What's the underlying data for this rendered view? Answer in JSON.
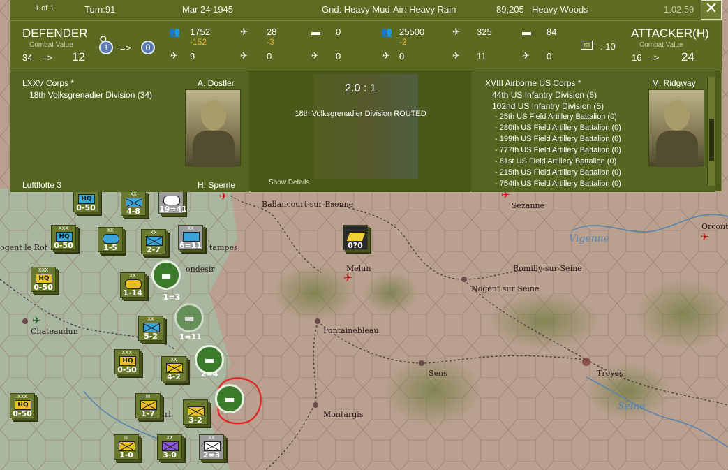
{
  "header": {
    "page": "1 of 1",
    "turn": "Turn:91",
    "date": "Mar 24 1945",
    "ground": "Gnd: Heavy Mud",
    "air": "Air: Heavy Rain",
    "terrain_count": "89,205",
    "terrain": "Heavy Woods",
    "version": "1.02.59",
    "close_icon": "close-icon"
  },
  "defender": {
    "title": "DEFENDER",
    "cv_label": "Combat Value",
    "cv_from": "34",
    "arrow": "=>",
    "cv_to": "12",
    "men": "1752",
    "men_loss": "-152",
    "guns": "9",
    "aa": "28",
    "aa_loss": "-3",
    "planes": "0",
    "tanks": "0",
    "air2": "0",
    "fort_from": "1",
    "fort_to": "0",
    "corps": "LXXV Corps *",
    "commander": "A. Dostler",
    "divisions": [
      "18th Volksgrenadier Division (34)"
    ],
    "cut_label": "Luftflotte 3",
    "cut_commander": "H. Sperrle"
  },
  "center": {
    "odds": "2.0 : 1",
    "result": "18th Volksgrenadier Division ROUTED",
    "show_details": "Show Details"
  },
  "attacker": {
    "title": "ATTACKER(H)",
    "cv_label": "Combat Value",
    "cv_from": "16",
    "arrow": "=>",
    "cv_to": "24",
    "men": "25500",
    "men_loss": "-2",
    "guns": "0",
    "aa": "325",
    "planes": "11",
    "tanks": "84",
    "air2": "0",
    "bridge_val": ": 10",
    "corps": "XVIII Airborne US Corps *",
    "commander": "M. Ridgway",
    "divisions": [
      "44th US Infantry Division (6)",
      "102nd US Infantry Division (5)"
    ],
    "units": [
      "- 25th US Field Artillery Battalion (0)",
      "- 280th US Field Artillery Battalion (0)",
      "- 199th US Field Artillery Battalion (0)",
      "- 777th US Field Artillery Battalion (0)",
      "- 81st US Field Artillery Battalion (0)",
      "- 215th US Field Artillery Battalion (0)",
      "- 754th US Field Artillery Battalion (0)"
    ]
  },
  "map": {
    "towns": [
      "Ballancourt-sur-Esonne",
      "Sezanne",
      "Orconte",
      "ogent le Rot",
      "tampes",
      "ondesir",
      "Melun",
      "Romilly-sur-Seine",
      "Nogent sur Seine",
      "Chateaudun",
      "Fontainebleau",
      "Sens",
      "Troyes",
      "Montargis",
      "rl"
    ],
    "rivers": [
      "Vigenne",
      "Seine"
    ],
    "units": [
      {
        "echelon": "",
        "value": "0-50",
        "type": "HQ"
      },
      {
        "echelon": "XX",
        "value": "4-8",
        "type": "inf"
      },
      {
        "echelon": "",
        "value": "19=41",
        "type": "arm"
      },
      {
        "echelon": "XXX",
        "value": "0-50",
        "type": "HQ"
      },
      {
        "echelon": "XX",
        "value": "1-5",
        "type": "arm"
      },
      {
        "echelon": "XX",
        "value": "2-7",
        "type": "inf"
      },
      {
        "echelon": "XX",
        "value": "6=11",
        "type": "gr"
      },
      {
        "echelon": "",
        "value": "0?0",
        "type": "para"
      },
      {
        "echelon": "XXX",
        "value": "0-50",
        "type": "HQ"
      },
      {
        "echelon": "XX",
        "value": "1-14",
        "type": "arm"
      },
      {
        "echelon": "",
        "value": "1=3",
        "type": "gr"
      },
      {
        "echelon": "XX",
        "value": "5-2",
        "type": "inf"
      },
      {
        "echelon": "",
        "value": "1=11",
        "type": "gr"
      },
      {
        "echelon": "XXX",
        "value": "0-50",
        "type": "HQ"
      },
      {
        "echelon": "XX",
        "value": "4-2",
        "type": "inf"
      },
      {
        "echelon": "",
        "value": "2=4",
        "type": "gr"
      },
      {
        "echelon": "XXX",
        "value": "0-50",
        "type": "HQ"
      },
      {
        "echelon": "III",
        "value": "1-7",
        "type": "inf"
      },
      {
        "echelon": "",
        "value": "3-2",
        "type": "inf"
      },
      {
        "echelon": "III",
        "value": "1-0",
        "type": "inf"
      },
      {
        "echelon": "XX",
        "value": "3-0",
        "type": "purple"
      },
      {
        "echelon": "XX",
        "value": "2=3",
        "type": "gr"
      }
    ]
  }
}
